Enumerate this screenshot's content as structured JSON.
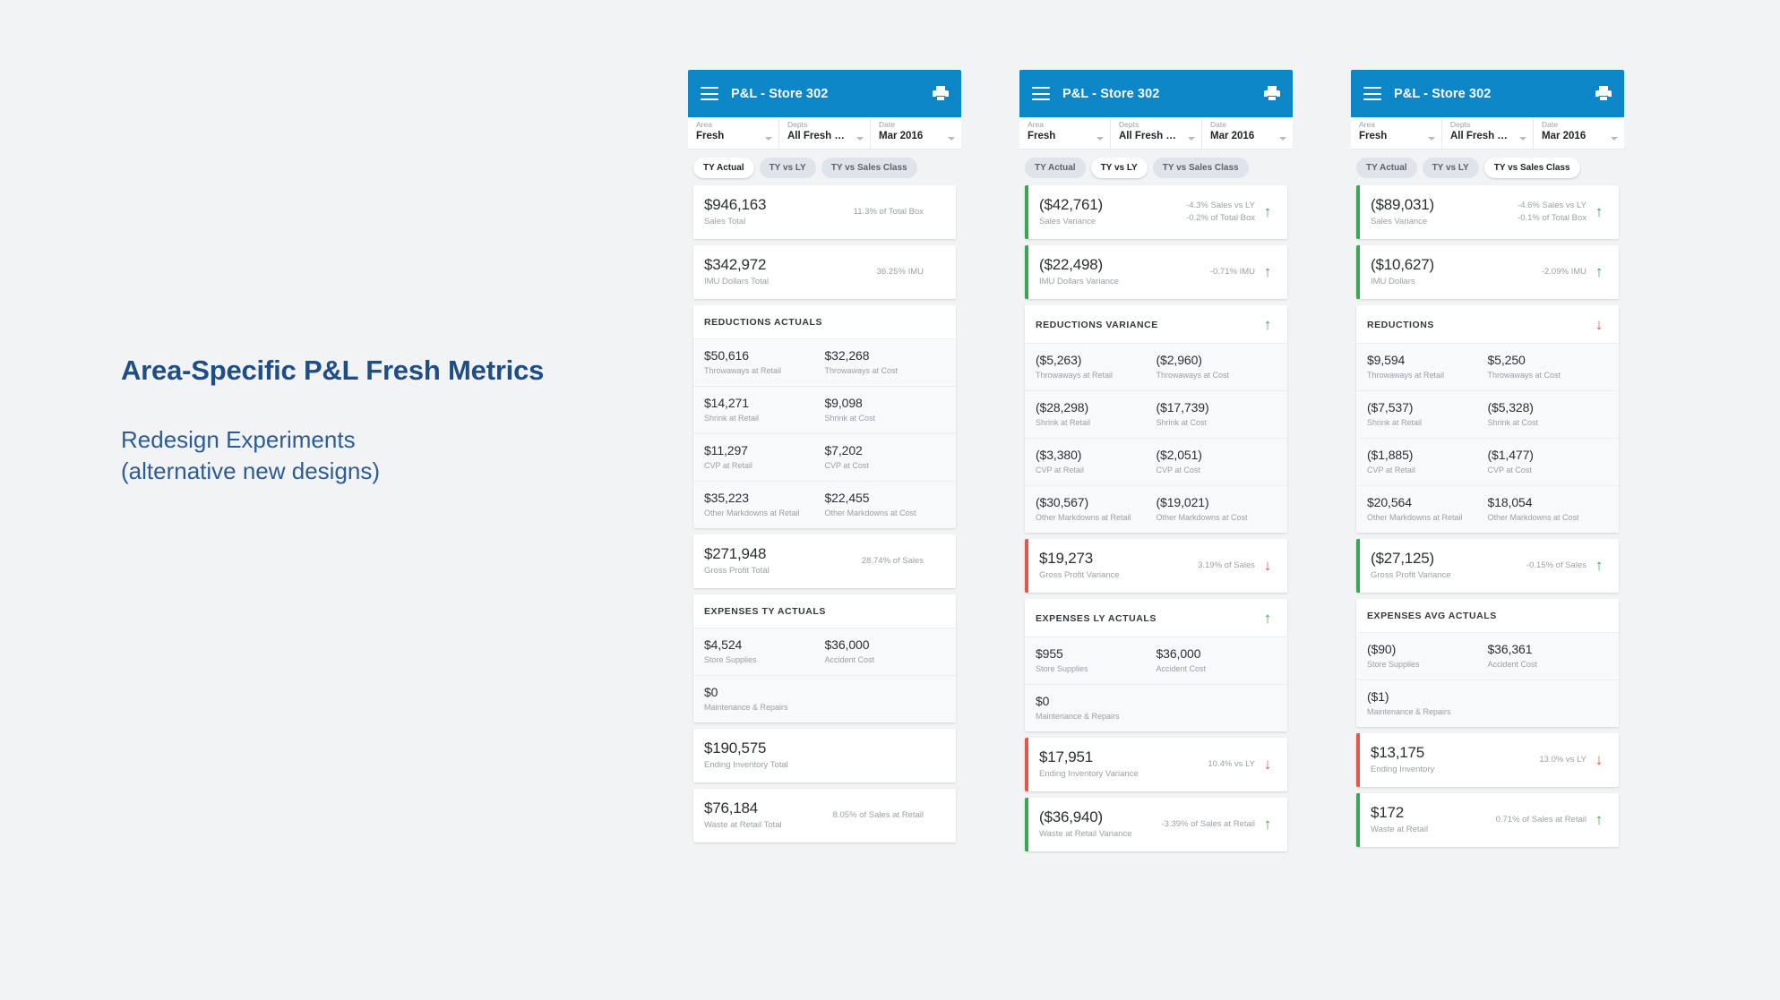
{
  "caption": {
    "title": "Area-Specific P&L Fresh Metrics",
    "subtitle_line1": "Redesign Experiments",
    "subtitle_line2": "(alternative new designs)"
  },
  "colors": {
    "appbar_blue": "#0d86c8",
    "positive_green": "#3aa653",
    "negative_red": "#e4574c",
    "caption_navy": "#1f4e85",
    "page_background": "#f1f3f5"
  },
  "cards": [
    {
      "appbar": {
        "title": "P&L - Store 302",
        "menu_icon": "hamburger-icon",
        "print_icon": "printer-icon"
      },
      "filters": [
        {
          "label": "Area",
          "value": "Fresh"
        },
        {
          "label": "Depts",
          "value": "All Fresh Depar..."
        },
        {
          "label": "Date",
          "value": "Mar 2016"
        }
      ],
      "tabs": [
        {
          "label": "TY Actual",
          "active": true
        },
        {
          "label": "TY vs LY",
          "active": false
        },
        {
          "label": "TY vs Sales Class",
          "active": false
        }
      ],
      "metrics": [
        {
          "value": "$946,163",
          "label": "Sales Total",
          "note": "11.3% of Total Box",
          "note2": "",
          "arrow": "none",
          "accent": "none"
        },
        {
          "value": "$342,972",
          "label": "IMU Dollars Total",
          "note": "36.25% IMU",
          "note2": "",
          "arrow": "none",
          "accent": "none"
        }
      ],
      "reductions": {
        "title": "REDUCTIONS ACTUALS",
        "arrow": "none",
        "rows": [
          {
            "left_value": "$50,616",
            "left_label": "Throwaways at Retail",
            "right_value": "$32,268",
            "right_label": "Throwaways at Cost"
          },
          {
            "left_value": "$14,271",
            "left_label": "Shrink at Retail",
            "right_value": "$9,098",
            "right_label": "Shrink at Cost"
          },
          {
            "left_value": "$11,297",
            "left_label": "CVP at Retail",
            "right_value": "$7,202",
            "right_label": "CVP at Cost"
          },
          {
            "left_value": "$35,223",
            "left_label": "Other Markdowns at Retail",
            "right_value": "$22,455",
            "right_label": "Other Markdowns at Cost"
          }
        ]
      },
      "gross_profit": {
        "value": "$271,948",
        "label": "Gross Profit Total",
        "note": "28.74% of Sales",
        "arrow": "none",
        "accent": "none"
      },
      "expenses": {
        "title": "EXPENSES TY ACTUALS",
        "arrow": "none",
        "rows": [
          {
            "left_value": "$4,524",
            "left_label": "Store Supplies",
            "right_value": "$36,000",
            "right_label": "Accident Cost"
          },
          {
            "left_value": "$0",
            "left_label": "Maintenance & Repairs",
            "right_value": "",
            "right_label": ""
          }
        ]
      },
      "footer_metrics": [
        {
          "value": "$190,575",
          "label": "Ending Inventory Total",
          "note": "",
          "arrow": "none",
          "accent": "none"
        },
        {
          "value": "$76,184",
          "label": "Waste at Retail Total",
          "note": "8.05% of Sales at Retail",
          "arrow": "none",
          "accent": "none"
        }
      ]
    },
    {
      "appbar": {
        "title": "P&L - Store 302",
        "menu_icon": "hamburger-icon",
        "print_icon": "printer-icon"
      },
      "filters": [
        {
          "label": "Area",
          "value": "Fresh"
        },
        {
          "label": "Depts",
          "value": "All Fresh Depar..."
        },
        {
          "label": "Date",
          "value": "Mar 2016"
        }
      ],
      "tabs": [
        {
          "label": "TY Actual",
          "active": false
        },
        {
          "label": "TY vs LY",
          "active": true
        },
        {
          "label": "TY vs Sales Class",
          "active": false
        }
      ],
      "metrics": [
        {
          "value": "($42,761)",
          "label": "Sales Variance",
          "note": "-4.3% Sales vs LY",
          "note2": "-0.2% of Total Box",
          "arrow": "up",
          "accent": "green"
        },
        {
          "value": "($22,498)",
          "label": "IMU Dollars Variance",
          "note": "-0.71% IMU",
          "note2": "",
          "arrow": "up",
          "accent": "green"
        }
      ],
      "reductions": {
        "title": "REDUCTIONS VARIANCE",
        "arrow": "up",
        "rows": [
          {
            "left_value": "($5,263)",
            "left_label": "Throwaways at Retail",
            "right_value": "($2,960)",
            "right_label": "Throwaways at Cost"
          },
          {
            "left_value": "($28,298)",
            "left_label": "Shrink at Retail",
            "right_value": "($17,739)",
            "right_label": "Shrink at Cost"
          },
          {
            "left_value": "($3,380)",
            "left_label": "CVP at Retail",
            "right_value": "($2,051)",
            "right_label": "CVP at Cost"
          },
          {
            "left_value": "($30,567)",
            "left_label": "Other Markdowns at Retail",
            "right_value": "($19,021)",
            "right_label": "Other Markdowns at Cost"
          }
        ]
      },
      "gross_profit": {
        "value": "$19,273",
        "label": "Gross Profit Variance",
        "note": "3.19% of Sales",
        "arrow": "down",
        "accent": "red"
      },
      "expenses": {
        "title": "EXPENSES LY ACTUALS",
        "arrow": "up",
        "rows": [
          {
            "left_value": "$955",
            "left_label": "Store Supplies",
            "right_value": "$36,000",
            "right_label": "Accident Cost"
          },
          {
            "left_value": "$0",
            "left_label": "Maintenance & Repairs",
            "right_value": "",
            "right_label": ""
          }
        ]
      },
      "footer_metrics": [
        {
          "value": "$17,951",
          "label": "Ending Inventory Variance",
          "note": "10.4% vs LY",
          "arrow": "down",
          "accent": "red"
        },
        {
          "value": "($36,940)",
          "label": "Waste at Retail Variance",
          "note": "-3.39% of Sales at Retail",
          "arrow": "up",
          "accent": "green"
        }
      ]
    },
    {
      "appbar": {
        "title": "P&L - Store 302",
        "menu_icon": "hamburger-icon",
        "print_icon": "printer-icon"
      },
      "filters": [
        {
          "label": "Area",
          "value": "Fresh"
        },
        {
          "label": "Depts",
          "value": "All Fresh Depar..."
        },
        {
          "label": "Date",
          "value": "Mar 2016"
        }
      ],
      "tabs": [
        {
          "label": "TY Actual",
          "active": false
        },
        {
          "label": "TY vs LY",
          "active": false
        },
        {
          "label": "TY vs Sales Class",
          "active": true
        }
      ],
      "metrics": [
        {
          "value": "($89,031)",
          "label": "Sales Variance",
          "note": "-4.6% Sales vs LY",
          "note2": "-0.1% of Total Box",
          "arrow": "up",
          "accent": "green"
        },
        {
          "value": "($10,627)",
          "label": "IMU Dollars",
          "note": "-2.09% IMU",
          "note2": "",
          "arrow": "up",
          "accent": "green"
        }
      ],
      "reductions": {
        "title": "REDUCTIONS",
        "arrow": "down",
        "rows": [
          {
            "left_value": "$9,594",
            "left_label": "Throwaways at Retail",
            "right_value": "$5,250",
            "right_label": "Throwaways at Cost"
          },
          {
            "left_value": "($7,537)",
            "left_label": "Shrink at Retail",
            "right_value": "($5,328)",
            "right_label": "Shrink at Cost"
          },
          {
            "left_value": "($1,885)",
            "left_label": "CVP at Retail",
            "right_value": "($1,477)",
            "right_label": "CVP at Cost"
          },
          {
            "left_value": "$20,564",
            "left_label": "Other Markdowns at Retail",
            "right_value": "$18,054",
            "right_label": "Other Markdowns at Cost"
          }
        ]
      },
      "gross_profit": {
        "value": "($27,125)",
        "label": "Gross Profit Variance",
        "note": "-0.15% of Sales",
        "arrow": "up",
        "accent": "green"
      },
      "expenses": {
        "title": "EXPENSES AVG ACTUALS",
        "arrow": "none",
        "rows": [
          {
            "left_value": "($90)",
            "left_label": "Store Supplies",
            "right_value": "$36,361",
            "right_label": "Accident Cost"
          },
          {
            "left_value": "($1)",
            "left_label": "Maintenance & Repairs",
            "right_value": "",
            "right_label": ""
          }
        ]
      },
      "footer_metrics": [
        {
          "value": "$13,175",
          "label": "Ending Inventory",
          "note": "13.0% vs LY",
          "arrow": "down",
          "accent": "red"
        },
        {
          "value": "$172",
          "label": "Waste at Retail",
          "note": "0.71% of Sales at Retail",
          "arrow": "up",
          "accent": "green"
        }
      ]
    }
  ]
}
